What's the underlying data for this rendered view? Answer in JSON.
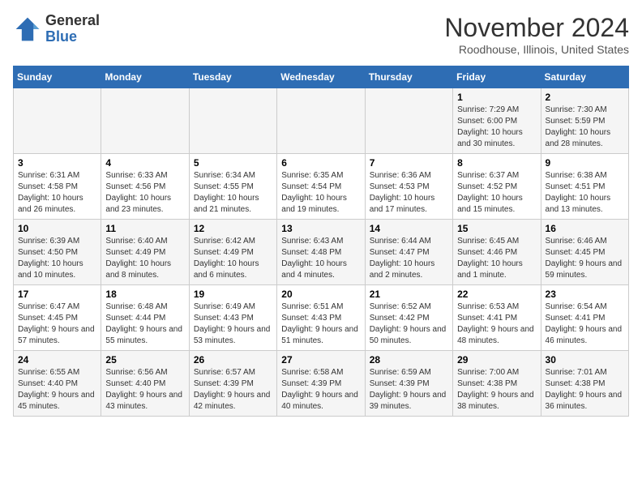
{
  "logo": {
    "general": "General",
    "blue": "Blue"
  },
  "title": "November 2024",
  "location": "Roodhouse, Illinois, United States",
  "days_of_week": [
    "Sunday",
    "Monday",
    "Tuesday",
    "Wednesday",
    "Thursday",
    "Friday",
    "Saturday"
  ],
  "weeks": [
    [
      {
        "day": "",
        "detail": ""
      },
      {
        "day": "",
        "detail": ""
      },
      {
        "day": "",
        "detail": ""
      },
      {
        "day": "",
        "detail": ""
      },
      {
        "day": "",
        "detail": ""
      },
      {
        "day": "1",
        "detail": "Sunrise: 7:29 AM\nSunset: 6:00 PM\nDaylight: 10 hours and 30 minutes."
      },
      {
        "day": "2",
        "detail": "Sunrise: 7:30 AM\nSunset: 5:59 PM\nDaylight: 10 hours and 28 minutes."
      }
    ],
    [
      {
        "day": "3",
        "detail": "Sunrise: 6:31 AM\nSunset: 4:58 PM\nDaylight: 10 hours and 26 minutes."
      },
      {
        "day": "4",
        "detail": "Sunrise: 6:33 AM\nSunset: 4:56 PM\nDaylight: 10 hours and 23 minutes."
      },
      {
        "day": "5",
        "detail": "Sunrise: 6:34 AM\nSunset: 4:55 PM\nDaylight: 10 hours and 21 minutes."
      },
      {
        "day": "6",
        "detail": "Sunrise: 6:35 AM\nSunset: 4:54 PM\nDaylight: 10 hours and 19 minutes."
      },
      {
        "day": "7",
        "detail": "Sunrise: 6:36 AM\nSunset: 4:53 PM\nDaylight: 10 hours and 17 minutes."
      },
      {
        "day": "8",
        "detail": "Sunrise: 6:37 AM\nSunset: 4:52 PM\nDaylight: 10 hours and 15 minutes."
      },
      {
        "day": "9",
        "detail": "Sunrise: 6:38 AM\nSunset: 4:51 PM\nDaylight: 10 hours and 13 minutes."
      }
    ],
    [
      {
        "day": "10",
        "detail": "Sunrise: 6:39 AM\nSunset: 4:50 PM\nDaylight: 10 hours and 10 minutes."
      },
      {
        "day": "11",
        "detail": "Sunrise: 6:40 AM\nSunset: 4:49 PM\nDaylight: 10 hours and 8 minutes."
      },
      {
        "day": "12",
        "detail": "Sunrise: 6:42 AM\nSunset: 4:49 PM\nDaylight: 10 hours and 6 minutes."
      },
      {
        "day": "13",
        "detail": "Sunrise: 6:43 AM\nSunset: 4:48 PM\nDaylight: 10 hours and 4 minutes."
      },
      {
        "day": "14",
        "detail": "Sunrise: 6:44 AM\nSunset: 4:47 PM\nDaylight: 10 hours and 2 minutes."
      },
      {
        "day": "15",
        "detail": "Sunrise: 6:45 AM\nSunset: 4:46 PM\nDaylight: 10 hours and 1 minute."
      },
      {
        "day": "16",
        "detail": "Sunrise: 6:46 AM\nSunset: 4:45 PM\nDaylight: 9 hours and 59 minutes."
      }
    ],
    [
      {
        "day": "17",
        "detail": "Sunrise: 6:47 AM\nSunset: 4:45 PM\nDaylight: 9 hours and 57 minutes."
      },
      {
        "day": "18",
        "detail": "Sunrise: 6:48 AM\nSunset: 4:44 PM\nDaylight: 9 hours and 55 minutes."
      },
      {
        "day": "19",
        "detail": "Sunrise: 6:49 AM\nSunset: 4:43 PM\nDaylight: 9 hours and 53 minutes."
      },
      {
        "day": "20",
        "detail": "Sunrise: 6:51 AM\nSunset: 4:43 PM\nDaylight: 9 hours and 51 minutes."
      },
      {
        "day": "21",
        "detail": "Sunrise: 6:52 AM\nSunset: 4:42 PM\nDaylight: 9 hours and 50 minutes."
      },
      {
        "day": "22",
        "detail": "Sunrise: 6:53 AM\nSunset: 4:41 PM\nDaylight: 9 hours and 48 minutes."
      },
      {
        "day": "23",
        "detail": "Sunrise: 6:54 AM\nSunset: 4:41 PM\nDaylight: 9 hours and 46 minutes."
      }
    ],
    [
      {
        "day": "24",
        "detail": "Sunrise: 6:55 AM\nSunset: 4:40 PM\nDaylight: 9 hours and 45 minutes."
      },
      {
        "day": "25",
        "detail": "Sunrise: 6:56 AM\nSunset: 4:40 PM\nDaylight: 9 hours and 43 minutes."
      },
      {
        "day": "26",
        "detail": "Sunrise: 6:57 AM\nSunset: 4:39 PM\nDaylight: 9 hours and 42 minutes."
      },
      {
        "day": "27",
        "detail": "Sunrise: 6:58 AM\nSunset: 4:39 PM\nDaylight: 9 hours and 40 minutes."
      },
      {
        "day": "28",
        "detail": "Sunrise: 6:59 AM\nSunset: 4:39 PM\nDaylight: 9 hours and 39 minutes."
      },
      {
        "day": "29",
        "detail": "Sunrise: 7:00 AM\nSunset: 4:38 PM\nDaylight: 9 hours and 38 minutes."
      },
      {
        "day": "30",
        "detail": "Sunrise: 7:01 AM\nSunset: 4:38 PM\nDaylight: 9 hours and 36 minutes."
      }
    ]
  ]
}
